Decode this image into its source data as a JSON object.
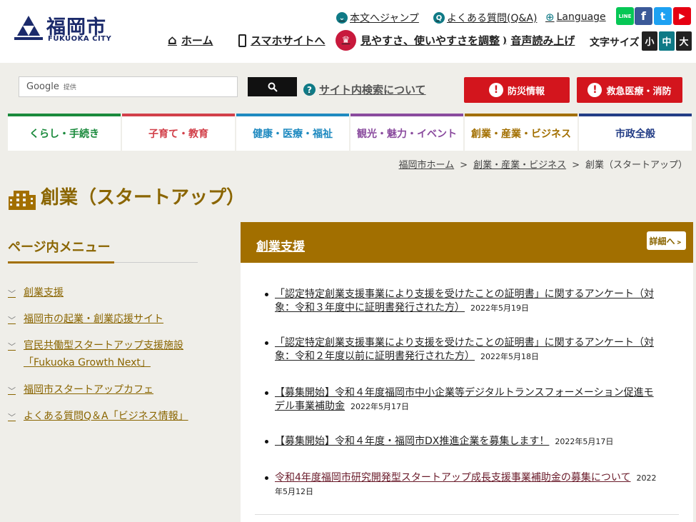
{
  "header": {
    "logo_ja": "福岡市",
    "logo_en": "FUKUOKA CITY",
    "skip_link": "本文へジャンプ",
    "faq_link": "よくある質問(Q&A)",
    "language_link": "Language",
    "nav": {
      "home": "ホーム",
      "mobile": "スマホサイトへ",
      "accessibility": "見やすさ、使いやすさを調整",
      "speech": "音声読み上げ"
    },
    "font_size_label": "文字サイズ",
    "font_sizes": [
      "小",
      "中",
      "大"
    ],
    "social": [
      "LINE",
      "f",
      "t",
      "▶"
    ]
  },
  "search": {
    "placeholder_brand": "Google",
    "placeholder_note": "提供",
    "about": "サイト内検索について"
  },
  "emergency": {
    "disaster": "防災情報",
    "medical": "救急医療・消防"
  },
  "categories": [
    {
      "label": "くらし・手続き",
      "color": "#1a8a3c"
    },
    {
      "label": "子育て・教育",
      "color": "#d2404a"
    },
    {
      "label": "健康・医療・福祉",
      "color": "#1f8ac0"
    },
    {
      "label": "観光・魅力・イベント",
      "color": "#8a4b9e"
    },
    {
      "label": "創業・産業・ビジネス",
      "color": "#a26f00"
    },
    {
      "label": "市政全般",
      "color": "#233d86"
    }
  ],
  "breadcrumb": {
    "home": "福岡市ホーム",
    "parent": "創業・産業・ビジネス",
    "current": "創業（スタートアップ）",
    "separator": ">"
  },
  "page_title": "創業（スタートアップ）",
  "side_menu": {
    "heading": "ページ内メニュー",
    "items": [
      "創業支援",
      "福岡市の起業・創業応援サイト",
      "官民共働型スタートアップ支援施設「Fukuoka Growth Next」",
      "福岡市スタートアップカフェ",
      "よくある質問Q＆A「ビジネス情報」"
    ]
  },
  "panel": {
    "title": "創業支援",
    "more": "詳細へ",
    "news": [
      {
        "text": "「認定特定創業支援事業により支援を受けたことの証明書」に関するアンケート（対象：令和３年度中に証明書発行された方）",
        "date": "2022年5月19日"
      },
      {
        "text": "「認定特定創業支援事業により支援を受けたことの証明書」に関するアンケート（対象：令和２年度以前に証明書発行された方）",
        "date": "2022年5月18日"
      },
      {
        "text": "【募集開始】令和４年度福岡市中小企業等デジタルトランスフォーメーション促進モデル事業補助金",
        "date": "2022年5月17日"
      },
      {
        "text": "【募集開始】令和４年度・福岡市DX推進企業を募集します！",
        "date": "2022年5月17日"
      },
      {
        "text": "令和4年度福岡市研究開発型スタートアップ成長支援事業補助金の募集について",
        "date": "2022年5月12日"
      }
    ]
  },
  "colors": {
    "brand_gold": "#a26f00",
    "alert_red": "#d3151d",
    "logo_navy": "#1b2a6b"
  }
}
